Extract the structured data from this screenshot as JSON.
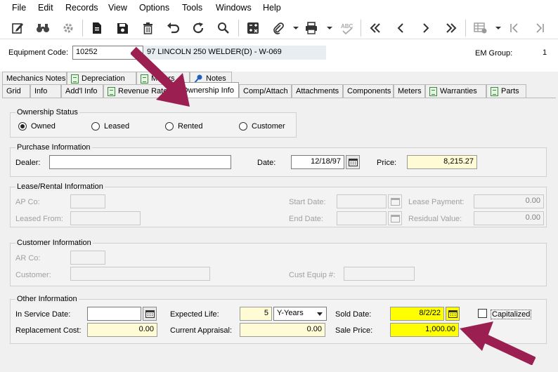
{
  "menu": [
    "File",
    "Edit",
    "Records",
    "View",
    "Options",
    "Tools",
    "Windows",
    "Help"
  ],
  "toolbar": {
    "icons": [
      "edit-icon",
      "binoculars-icon",
      "gear-icon",
      "document-icon",
      "save-icon",
      "trash-icon",
      "undo-icon",
      "refresh-icon",
      "search-icon",
      "calculator-icon",
      "paperclip-icon",
      "printer-icon",
      "spellcheck-icon",
      "first-record-icon",
      "previous-record-icon",
      "next-record-icon",
      "last-record-icon",
      "grid-settings-icon",
      "first-icon",
      "last-icon"
    ]
  },
  "header": {
    "equipment_code_label": "Equipment Code:",
    "equipment_code": "10252",
    "equipment_description": "97 LINCOLN 250 WELDER(D) - W-069",
    "em_group_label": "EM Group:",
    "em_group": "1"
  },
  "tabs_row1": [
    "Mechanics Notes",
    "Depreciation",
    "Meters",
    "Notes"
  ],
  "tabs_row2": [
    "Grid",
    "Info",
    "Add'l Info",
    "Revenue Rates",
    "Ownership Info",
    "Comp/Attach",
    "Attachments",
    "Components",
    "Meters",
    "Warranties",
    "Parts"
  ],
  "active_tab": "Ownership Info",
  "ownership_status": {
    "title": "Ownership Status",
    "options": [
      "Owned",
      "Leased",
      "Rented",
      "Customer"
    ],
    "selected": "Owned"
  },
  "purchase": {
    "title": "Purchase Information",
    "dealer_label": "Dealer:",
    "dealer": "",
    "date_label": "Date:",
    "date": "12/18/97",
    "price_label": "Price:",
    "price": "8,215.27"
  },
  "lease": {
    "title": "Lease/Rental Information",
    "ap_co_label": "AP Co:",
    "ap_co": "",
    "leased_from_label": "Leased From:",
    "leased_from": "",
    "start_date_label": "Start Date:",
    "start_date": "",
    "end_date_label": "End Date:",
    "end_date": "",
    "lease_payment_label": "Lease Payment:",
    "lease_payment": "0.00",
    "residual_value_label": "Residual Value:",
    "residual_value": "0.00"
  },
  "customer": {
    "title": "Customer Information",
    "ar_co_label": "AR Co:",
    "ar_co": "",
    "customer_label": "Customer:",
    "customer": "",
    "cust_equip_label": "Cust Equip #:",
    "cust_equip": ""
  },
  "other": {
    "title": "Other Information",
    "in_service_label": "In Service Date:",
    "in_service": "",
    "expected_life_label": "Expected Life:",
    "expected_life": "5",
    "life_unit": "Y-Years",
    "sold_date_label": "Sold Date:",
    "sold_date": "8/2/22",
    "capitalized_label": "Capitalized",
    "replacement_cost_label": "Replacement Cost:",
    "replacement_cost": "0.00",
    "current_appraisal_label": "Current Appraisal:",
    "current_appraisal": "0.00",
    "sale_price_label": "Sale Price:",
    "sale_price": "1,000.00"
  },
  "colors": {
    "highlight_yellow": "#ffff00",
    "field_yellow": "#fffbd5",
    "annotation_arrow": "#9b1f50"
  }
}
